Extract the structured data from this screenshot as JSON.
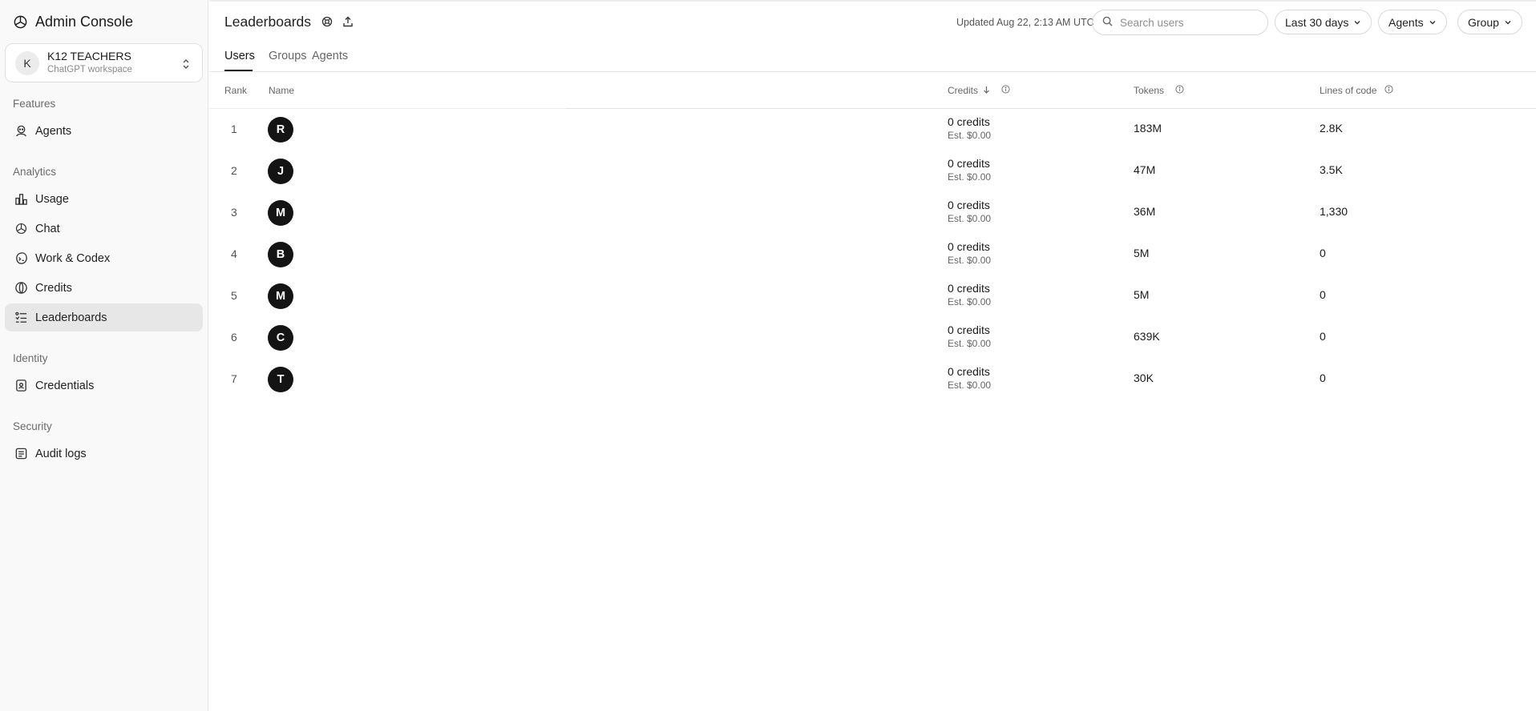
{
  "app": {
    "title": "Admin Console"
  },
  "workspace": {
    "initial": "K",
    "name": "K12 TEACHERS",
    "subtitle": "ChatGPT workspace"
  },
  "sidebar": {
    "sections": [
      {
        "label": "Features"
      },
      {
        "label": "Analytics"
      },
      {
        "label": "Identity"
      },
      {
        "label": "Security"
      }
    ],
    "items": [
      {
        "label": "Agents",
        "icon": "agents-icon"
      },
      {
        "label": "Usage",
        "icon": "bar-chart-icon"
      },
      {
        "label": "Chat",
        "icon": "chat-logo-icon"
      },
      {
        "label": "Work & Codex",
        "icon": "codex-icon"
      },
      {
        "label": "Credits",
        "icon": "credits-icon"
      },
      {
        "label": "Leaderboards",
        "icon": "leaderboard-icon",
        "active": true
      },
      {
        "label": "Credentials",
        "icon": "badge-icon"
      },
      {
        "label": "Audit logs",
        "icon": "log-icon"
      }
    ]
  },
  "header": {
    "title": "Leaderboards",
    "updated": "Updated Aug 22, 2:13 AM UTC",
    "search_placeholder": "Search users",
    "filters": {
      "range": "Last 30 days",
      "type": "Agents",
      "group": "Group"
    }
  },
  "tabs": [
    {
      "label": "Users",
      "active": true
    },
    {
      "label": "Groups"
    },
    {
      "label": "Agents"
    }
  ],
  "table": {
    "columns": {
      "rank": "Rank",
      "name": "Name",
      "credits": "Credits",
      "tokens": "Tokens",
      "loc": "Lines of code"
    },
    "rows": [
      {
        "rank": "1",
        "initial": "R",
        "credits": "0 credits",
        "est": "Est. $0.00",
        "tokens": "183M",
        "loc": "2.8K"
      },
      {
        "rank": "2",
        "initial": "J",
        "credits": "0 credits",
        "est": "Est. $0.00",
        "tokens": "47M",
        "loc": "3.5K"
      },
      {
        "rank": "3",
        "initial": "M",
        "credits": "0 credits",
        "est": "Est. $0.00",
        "tokens": "36M",
        "loc": "1,330"
      },
      {
        "rank": "4",
        "initial": "B",
        "credits": "0 credits",
        "est": "Est. $0.00",
        "tokens": "5M",
        "loc": "0"
      },
      {
        "rank": "5",
        "initial": "M",
        "credits": "0 credits",
        "est": "Est. $0.00",
        "tokens": "5M",
        "loc": "0"
      },
      {
        "rank": "6",
        "initial": "C",
        "credits": "0 credits",
        "est": "Est. $0.00",
        "tokens": "639K",
        "loc": "0"
      },
      {
        "rank": "7",
        "initial": "T",
        "credits": "0 credits",
        "est": "Est. $0.00",
        "tokens": "30K",
        "loc": "0"
      }
    ]
  }
}
